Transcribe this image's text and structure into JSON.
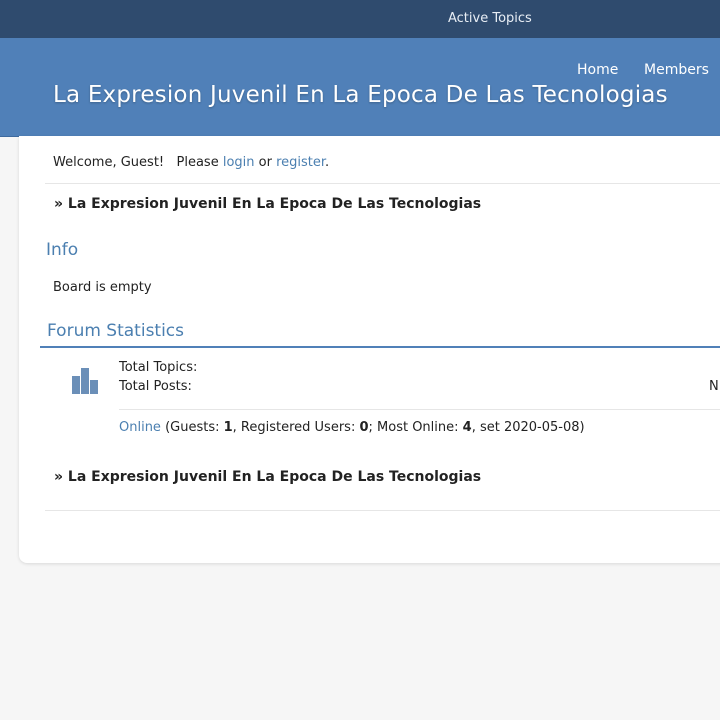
{
  "topbar": {
    "active_topics": "Active Topics"
  },
  "header": {
    "nav_home": "Home",
    "nav_members": "Members",
    "site_title": "La Expresion Juvenil En La Epoca De Las Tecnologias"
  },
  "welcome": {
    "prefix": "Welcome, Guest!   Please ",
    "login": "login",
    "or": " or ",
    "register": "register",
    "suffix": "."
  },
  "breadcrumb": {
    "text": "» La Expresion Juvenil En La Epoca De Las Tecnologias"
  },
  "info": {
    "heading": "Info",
    "board_status": "Board is empty"
  },
  "stats": {
    "heading": "Forum Statistics",
    "total_topics_label": "Total Topics:",
    "total_posts_label": "Total Posts:",
    "truncated_value": "N",
    "icon": "bar-chart-icon",
    "icon_color": "#6b8fb8",
    "online": {
      "link": "Online",
      "t1": " (Guests: ",
      "guests": "1",
      "t2": ", Registered Users: ",
      "registered": "0",
      "t3": "; Most Online: ",
      "most_online": "4",
      "t4": ", set 2020-05-08)"
    }
  },
  "colors": {
    "topbar": "#2f4b6e",
    "header": "#5080b8",
    "link": "#4b7fb0"
  }
}
